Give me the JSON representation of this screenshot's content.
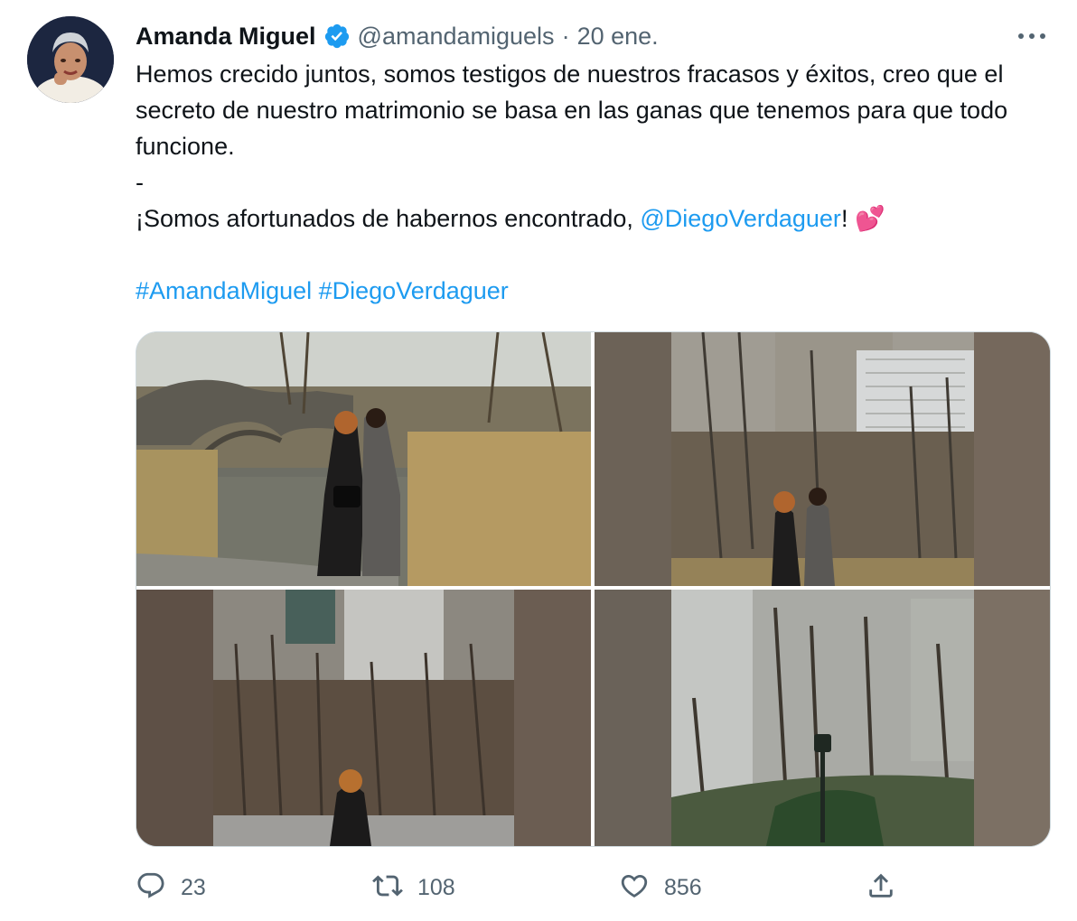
{
  "tweet": {
    "author_name": "Amanda Miguel",
    "handle": "@amandamiguels",
    "separator": "·",
    "date": "20 ene.",
    "text_lines": [
      "Hemos crecido juntos, somos testigos de nuestros fracasos y éxitos, creo que el secreto de nuestro matrimonio se basa en las ganas que tenemos para que todo funcione.",
      "-"
    ],
    "text_line3_before": "¡Somos afortunados de habernos encontrado, ",
    "mention": "@DiegoVerdaguer",
    "text_line3_after": "! ",
    "emoji": "💕",
    "hashtags": [
      "#AmandaMiguel",
      "#DiegoVerdaguer"
    ]
  },
  "stats": {
    "replies": "23",
    "retweets": "108",
    "likes": "856"
  },
  "colors": {
    "link": "#1d9bf0",
    "verified": "#1d9bf0",
    "secondary_text": "#536471",
    "border": "#cfd9de"
  },
  "icons": [
    "verified-badge-icon",
    "more-options-icon",
    "reply-icon",
    "retweet-icon",
    "like-icon",
    "share-icon"
  ]
}
